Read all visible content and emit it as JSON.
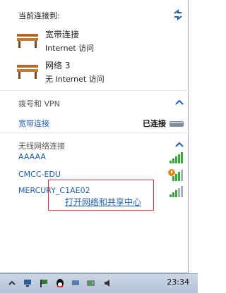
{
  "panel": {
    "current_header": "当前连接到:",
    "connections": [
      {
        "name": "宽带连接",
        "status": "Internet 访问"
      },
      {
        "name": "网络  3",
        "status": "无 Internet 访问"
      }
    ],
    "dialup": {
      "title": "拨号和 VPN",
      "item": {
        "label": "宽带连接",
        "status": "已连接"
      }
    },
    "wireless": {
      "title": "无线网络连接",
      "networks": [
        {
          "ssid": "AAAAA",
          "signal": 5,
          "secured": false
        },
        {
          "ssid": "CMCC-EDU",
          "signal": 4,
          "secured": true
        },
        {
          "ssid": "MERCURY_C1AE02",
          "signal": 3,
          "secured": false
        }
      ]
    },
    "open_center_link": "打开网络和共享中心"
  },
  "taskbar": {
    "time": "23:34",
    "tray_icons": [
      "tray-expand-icon",
      "network-icon",
      "qq-icon",
      "battery-icon",
      "volume-icon",
      "input-method-icon"
    ]
  },
  "colors": {
    "link": "#1f5fb3",
    "highlight_box": "#d33333",
    "taskbar": "#b3c2d6"
  }
}
